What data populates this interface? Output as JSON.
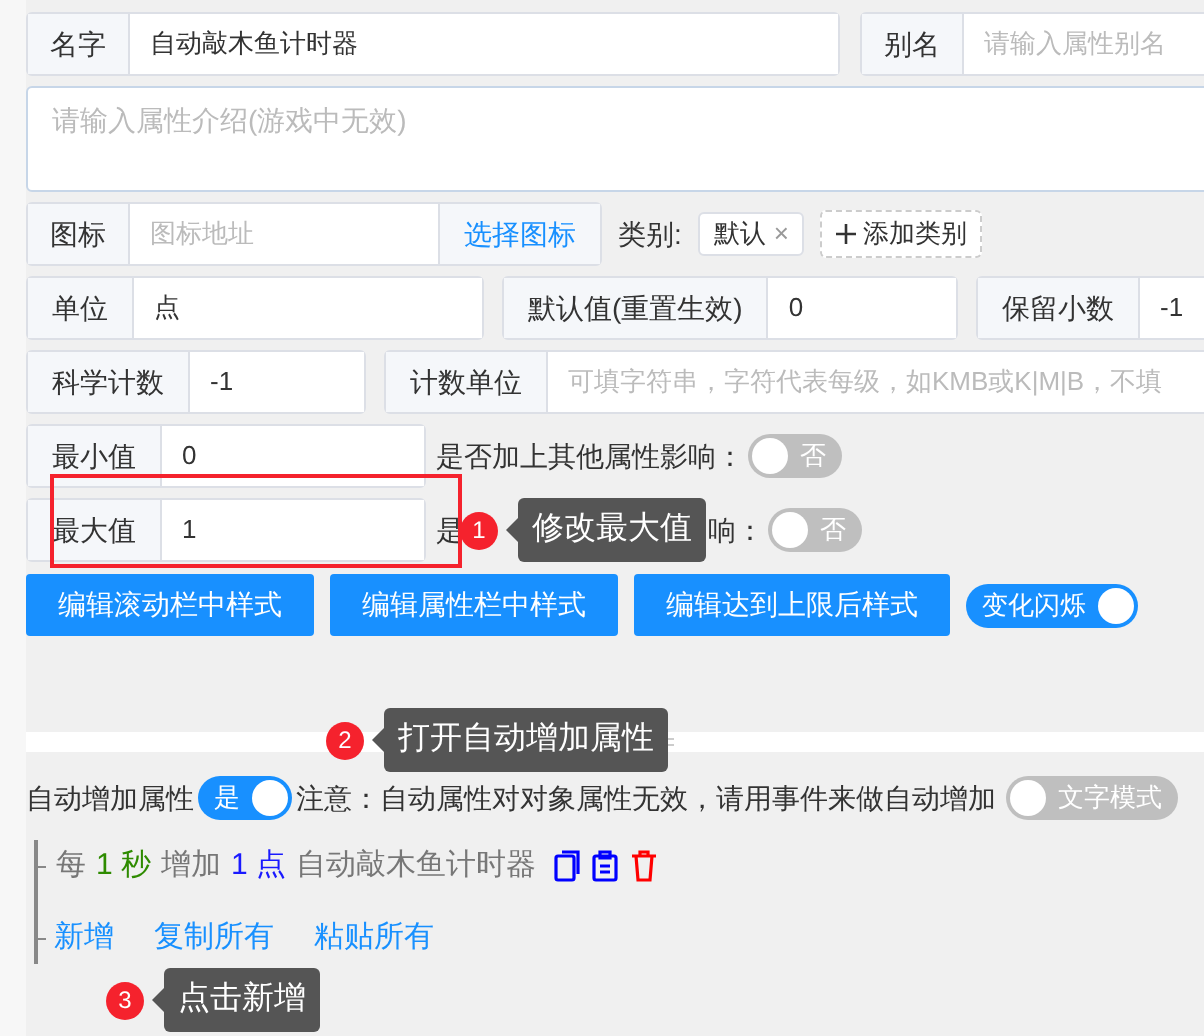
{
  "name_field": {
    "label": "名字",
    "value": "自动敲木鱼计时器"
  },
  "alias_field": {
    "label": "别名",
    "placeholder": "请输入属性别名"
  },
  "description": {
    "placeholder": "请输入属性介绍(游戏中无效)"
  },
  "icon_field": {
    "label": "图标",
    "placeholder": "图标地址",
    "button": "选择图标"
  },
  "category": {
    "label": "类别:",
    "tags": [
      {
        "text": "默认",
        "remove": "×"
      }
    ],
    "add_button": "添加类别"
  },
  "fields_row1": [
    {
      "label": "单位",
      "value": "点"
    },
    {
      "label": "默认值(重置生效)",
      "value": "0"
    },
    {
      "label": "保留小数",
      "value": "-1"
    }
  ],
  "fields_row2": [
    {
      "label": "科学计数",
      "value": "-1"
    },
    {
      "label": "计数单位",
      "placeholder": "可填字符串，字符代表每级，如KMB或K|M|B，不填"
    }
  ],
  "limits": [
    {
      "label": "最小值",
      "value": "0",
      "highlighted": false,
      "affect_label": [
        "是否加上其他属性影响："
      ],
      "switch": {
        "text": "否",
        "on": false
      }
    },
    {
      "label": "最大值",
      "value": "1",
      "highlighted": true,
      "affect_label": [
        "是",
        "响："
      ],
      "switch": {
        "text": "否",
        "on": false
      }
    }
  ],
  "style_buttons": [
    "编辑滚动栏中样式",
    "编辑属性栏中样式",
    "编辑达到上限后样式"
  ],
  "flash_switch": {
    "text": "变化闪烁",
    "on": true
  },
  "annotations": [
    {
      "number": "1",
      "text": "修改最大值"
    },
    {
      "number": "2",
      "text": "打开自动增加属性"
    },
    {
      "number": "3",
      "text": "点击新增"
    }
  ],
  "auto_increase": {
    "label": "自动增加属性",
    "switch": {
      "text": "是",
      "on": true
    },
    "note": "注意：自动属性对对象属性无效，请用事件来做自动增加",
    "text_mode_switch": {
      "text": "文字模式",
      "on": false
    }
  },
  "rules": [
    {
      "prefix": "每",
      "interval": "1 秒",
      "verb": "增加",
      "amount": "1 点",
      "target": "自动敲木鱼计时器"
    }
  ],
  "actions": [
    "新增",
    "复制所有",
    "粘贴所有"
  ]
}
